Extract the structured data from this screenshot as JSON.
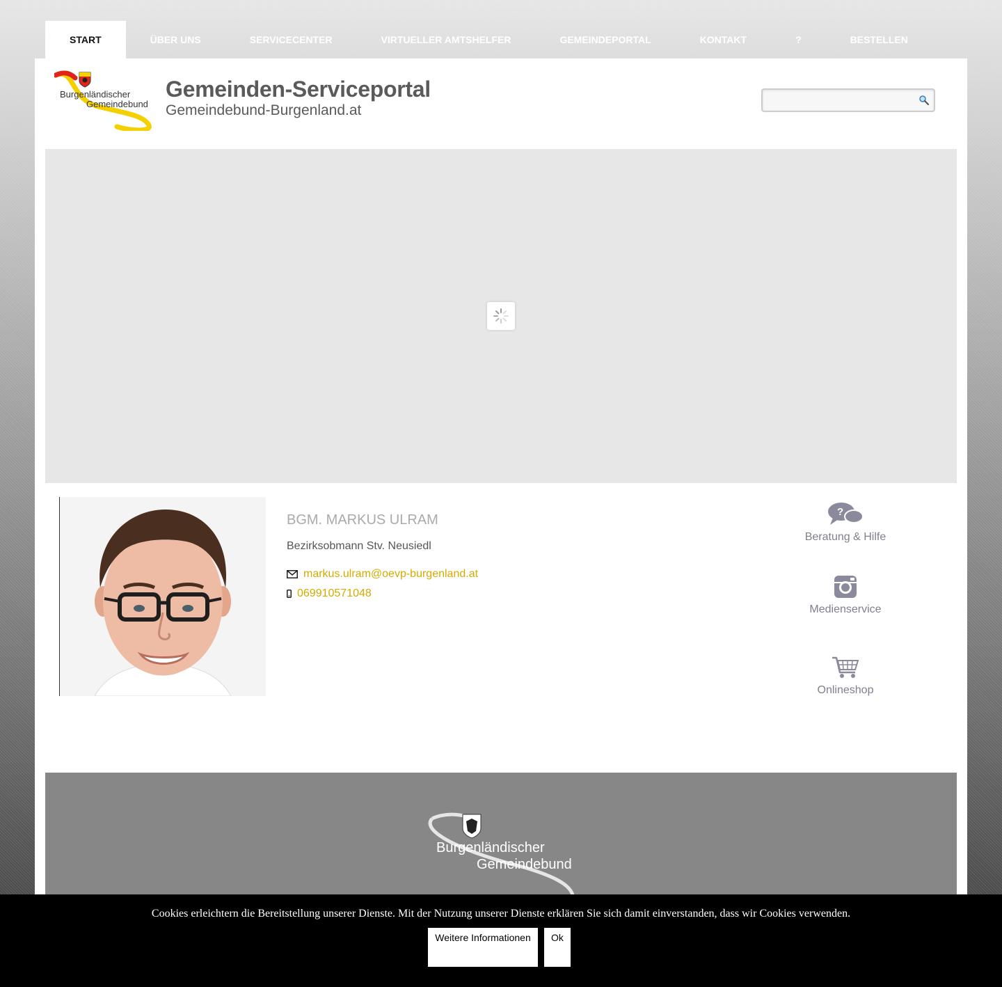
{
  "nav": {
    "items": [
      {
        "label": "START"
      },
      {
        "label": "ÜBER UNS"
      },
      {
        "label": "SERVICECENTER"
      },
      {
        "label": "VIRTUELLER AMTSHELFER"
      },
      {
        "label": "GEMEINDEPORTAL"
      },
      {
        "label": "KONTAKT"
      },
      {
        "label": "?"
      },
      {
        "label": "BESTELLEN"
      }
    ],
    "active_index": 0
  },
  "header": {
    "logo_text_line1": "Burgenländischer",
    "logo_text_line2": "Gemeindebund",
    "title": "Gemeinden-Serviceportal",
    "subtitle": "Gemeindebund-Burgenland.at",
    "search_value": ""
  },
  "profile": {
    "name": "BGM. MARKUS ULRAM",
    "role": "Bezirksobmann Stv. Neusiedl",
    "email": "markus.ulram@oevp-burgenland.at",
    "phone": "069910571048"
  },
  "services": {
    "beratung_label": "Beratung & Hilfe",
    "medien_label": "Medienservice",
    "shop_label": "Onlineshop"
  },
  "footer": {
    "logo_text_line1": "Burgenländischer",
    "logo_text_line2": "Gemeindebund"
  },
  "cookie": {
    "text": "Cookies erleichtern die Bereitstellung unserer Dienste. Mit der Nutzung unserer Dienste erklären Sie sich damit einverstanden, dass wir Cookies verwenden.",
    "more_label": "Weitere Informationen",
    "ok_label": "Ok"
  },
  "colors": {
    "accent_link": "#d4aa00",
    "service_icon": "#7f7f90",
    "footer_bg": "#878787",
    "cookie_bg": "#000000"
  }
}
